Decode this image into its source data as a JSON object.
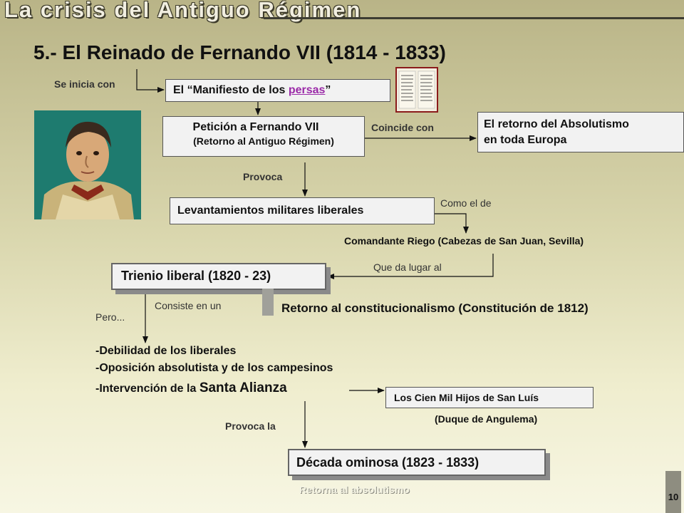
{
  "header": {
    "title": "La crisis del Antiguo Régimen"
  },
  "page": {
    "title": "5.- El Reinado de Fernando VII (1814 - 1833)",
    "number": "10"
  },
  "flow": {
    "se_inicia": "Se inicia con",
    "manifiesto_prefix": "El “Manifiesto de los ",
    "manifiesto_link": "persas",
    "manifiesto_suffix": "”",
    "peticion_line1": "Petición a Fernando VII",
    "peticion_line2": "(Retorno al Antiguo Régimen)",
    "coincide": "Coincide con",
    "absolutismo_line1": "El retorno del Absolutismo",
    "absolutismo_line2": "en toda Europa",
    "provoca": "Provoca",
    "levantamientos": "Levantamientos militares liberales",
    "como_el_de": "Como el de",
    "riego": "Comandante Riego (Cabezas de San Juan, Sevilla)",
    "que_da_lugar": "Que da lugar al",
    "trienio": "Trienio liberal (1820 - 23)",
    "consiste": "Consiste en un",
    "retorno_const": "Retorno al constitucionalismo (Constitución de 1812)",
    "pero": "Pero...",
    "causa1": "-Debilidad de los liberales",
    "causa2": "-Oposición absolutista y de los campesinos",
    "causa3_prefix": "-Intervención de la ",
    "causa3_emph": "Santa Alianza",
    "cien_mil": "Los Cien Mil Hijos de San Luís",
    "duque": "(Duque de Angulema)",
    "provoca_la": "Provoca la",
    "decada": "Década ominosa (1823 - 1833)",
    "retorna": "Retorna al absolutismo"
  },
  "colors": {
    "link": "#9b2aa8",
    "portrait_bg": "#1e7b6f",
    "header_line": "#3d3d33"
  },
  "icons": {
    "document": "document-thumbnail-icon",
    "portrait": "portrait-image"
  }
}
